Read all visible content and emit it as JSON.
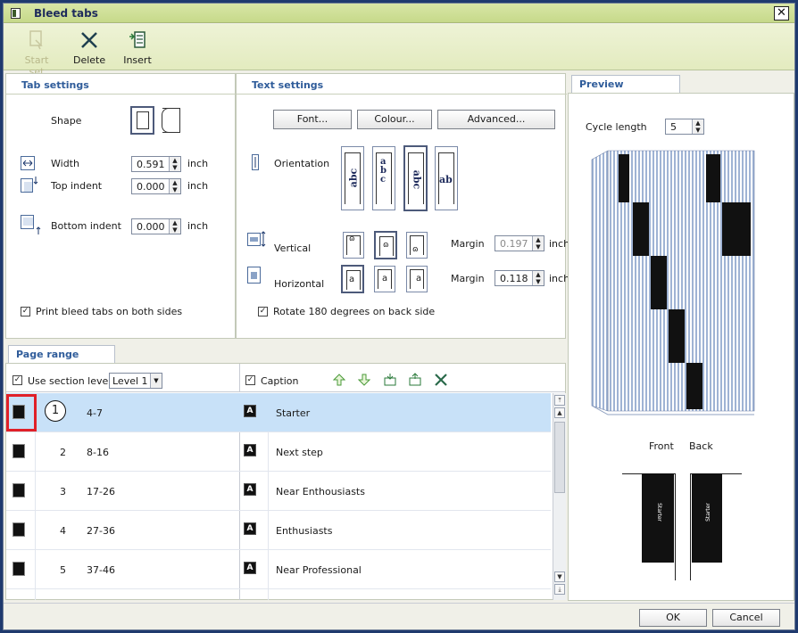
{
  "window": {
    "title": "Bleed tabs",
    "close_glyph": "✕"
  },
  "toolbar": {
    "start_set": "Start set",
    "delete": "Delete",
    "insert": "Insert"
  },
  "tab_settings": {
    "header": "Tab settings",
    "shape_label": "Shape",
    "width_label": "Width",
    "width_value": "0.591",
    "width_unit": "inch",
    "top_indent_label": "Top indent",
    "top_indent_value": "0.000",
    "top_indent_unit": "inch",
    "bottom_indent_label": "Bottom indent",
    "bottom_indent_value": "0.000",
    "bottom_indent_unit": "inch",
    "print_both_label": "Print bleed tabs on both sides"
  },
  "text_settings": {
    "header": "Text settings",
    "font_button": "Font...",
    "colour_button": "Colour...",
    "advanced_button": "Advanced...",
    "orientation_label": "Orientation",
    "orient_samples": [
      "abc",
      "abc",
      "abc",
      "ab"
    ],
    "vertical_label": "Vertical",
    "horizontal_label": "Horizontal",
    "vert_glyph": "ɷ",
    "horiz_glyph": "a",
    "margin_label": "Margin",
    "margin_v_value": "0.197",
    "margin_v_unit": "inch",
    "margin_h_value": "0.118",
    "margin_h_unit": "inch",
    "rotate_label": "Rotate 180 degrees on back side"
  },
  "preview": {
    "tab": "Preview",
    "cycle_label": "Cycle length",
    "cycle_value": "5",
    "front_label": "Front",
    "back_label": "Back",
    "front_caption": "Starter",
    "back_caption": "Starter"
  },
  "page_range": {
    "tab": "Page range",
    "use_section_label": "Use section level",
    "level_value": "Level 1",
    "caption_label": "Caption",
    "callout": "1",
    "rows": [
      {
        "num": "1",
        "range": "4-7",
        "caption": "Starter"
      },
      {
        "num": "2",
        "range": "8-16",
        "caption": "Next step"
      },
      {
        "num": "3",
        "range": "17-26",
        "caption": "Near Enthousiasts"
      },
      {
        "num": "4",
        "range": "27-36",
        "caption": "Enthusiasts"
      },
      {
        "num": "5",
        "range": "37-46",
        "caption": "Near Professional"
      }
    ]
  },
  "footer": {
    "ok": "OK",
    "cancel": "Cancel"
  }
}
